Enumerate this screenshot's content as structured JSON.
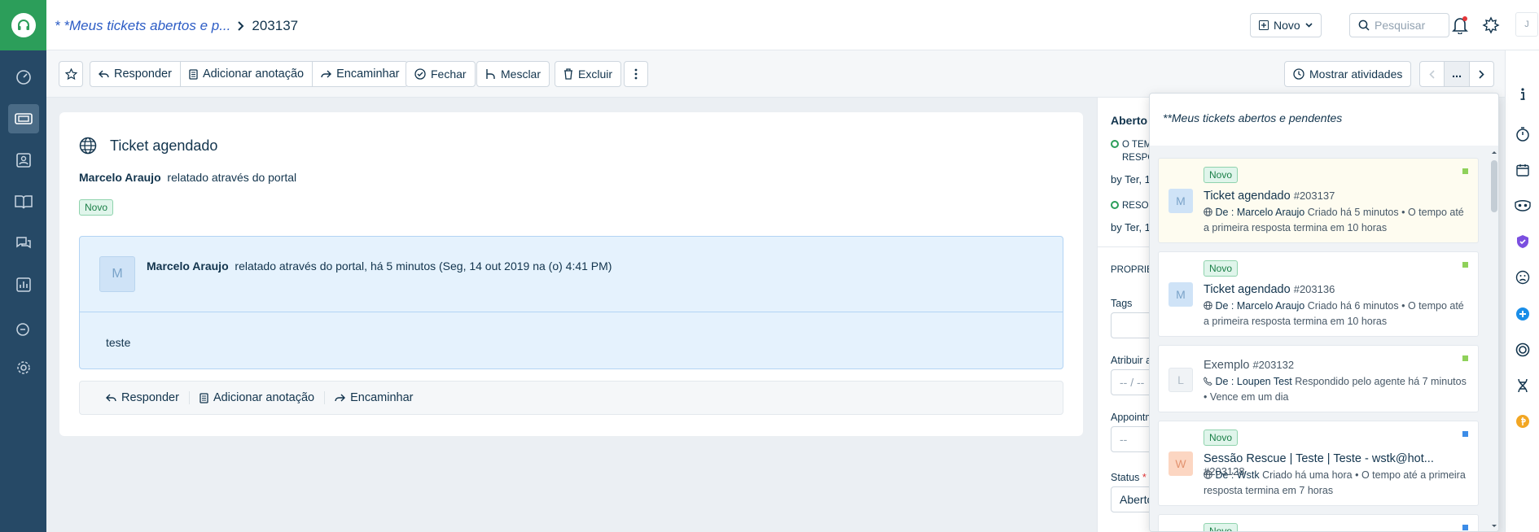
{
  "breadcrumb": {
    "list": "* *Meus tickets abertos e p...",
    "ticket_id": "203137"
  },
  "header": {
    "new_label": "Novo",
    "search_placeholder": "Pesquisar",
    "user_initial": "J"
  },
  "toolbar": {
    "reply": "Responder",
    "add_note": "Adicionar anotação",
    "forward": "Encaminhar",
    "close": "Fechar",
    "merge": "Mesclar",
    "delete": "Excluir",
    "show_activities": "Mostrar atividades",
    "more": "..."
  },
  "ticket": {
    "title": "Ticket agendado",
    "reporter": "Marcelo Araujo",
    "reported_via": "relatado através do portal",
    "status_badge": "Novo",
    "message": {
      "avatar": "M",
      "author": "Marcelo Araujo",
      "meta": "relatado através do portal, há 5 minutos (Seg, 14 out 2019 na (o) 4:41 PM)",
      "body": "teste"
    },
    "actions": {
      "reply": "Responder",
      "add_note": "Adicionar anotação",
      "forward": "Encaminhar"
    }
  },
  "properties": {
    "status_heading": "Aberto",
    "sla1_line1": "O TEM",
    "sla1_line2": "RESPO",
    "sla1_by": "by Ter, 1",
    "sla2_line1": "RESOL",
    "sla2_by": "by Ter, 1",
    "section": "PROPRIE",
    "tags_label": "Tags",
    "assign_label": "Atribuir a",
    "assign_value": "-- / --",
    "appointment_label": "Appointm",
    "appointment_value": "--",
    "status_label": "Status",
    "status_required": "*",
    "status_value": "Aberto"
  },
  "dropdown": {
    "title": "**Meus tickets abertos e pendentes",
    "items": [
      {
        "badge": "Novo",
        "avatar": "M",
        "name": "Ticket agendado",
        "number": "#203137",
        "from": "De : Marcelo Araujo",
        "created": "Criado há 5 minutos",
        "sla": "O tempo até a primeira resposta termina em 10 horas",
        "dot_color": "#8fd15a"
      },
      {
        "badge": "Novo",
        "avatar": "M",
        "name": "Ticket agendado",
        "number": "#203136",
        "from": "De : Marcelo Araujo",
        "created": "Criado há 6 minutos",
        "sla": "O tempo até a primeira resposta termina em 10 horas",
        "dot_color": "#8fd15a"
      },
      {
        "badge": "",
        "avatar": "L",
        "name": "Exemplo",
        "number": "#203132",
        "from": "De : Loupen Test",
        "created": "Respondido pelo agente há 7 minutos",
        "sla": "Vence em um dia",
        "dot_color": "#8fd15a"
      },
      {
        "badge": "Novo",
        "avatar": "W",
        "name": "Sessão Rescue | Teste | Teste - wstk@hot...",
        "number": "#203128",
        "from": "De : Wstk",
        "created": "Criado há uma hora",
        "sla": "O tempo até a primeira resposta termina em 7 horas",
        "dot_color": "#3c8ce7"
      },
      {
        "badge": "Novo",
        "dot_color": "#3c8ce7"
      }
    ]
  },
  "colors": {
    "brand_green": "#2c9e5a",
    "rail": "#264966",
    "link": "#2c5cc5"
  }
}
